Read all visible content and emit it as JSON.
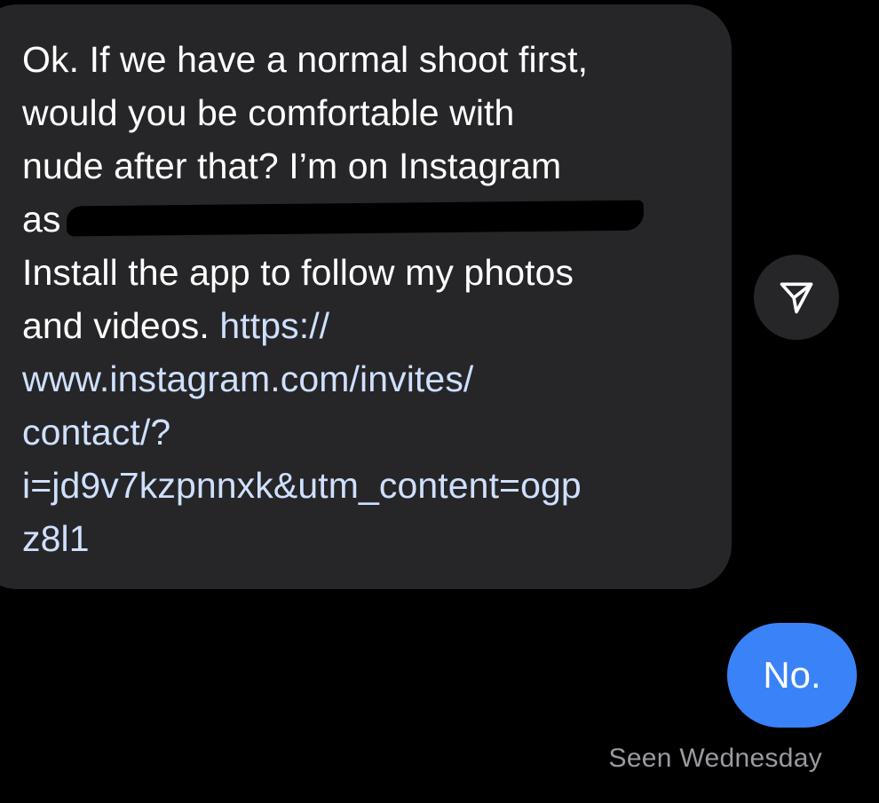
{
  "incoming_message": {
    "lines": [
      "Ok. If we have a normal shoot first,",
      "would you be comfortable with",
      "nude after that? I’m on Instagram",
      "as",
      "Install the app to follow my photos",
      "and videos."
    ],
    "link_lines": [
      "https://",
      "www.instagram.com/invites/",
      "contact/?",
      "i=jd9v7kzpnnxk&utm_content=ogp",
      "z8l1"
    ],
    "redacted": true
  },
  "share_button": {
    "icon": "paper-plane-icon"
  },
  "outgoing_message": {
    "text": "No."
  },
  "status": {
    "seen": "Seen Wednesday"
  },
  "colors": {
    "background": "#000000",
    "incoming_bubble": "#262628",
    "outgoing_bubble": "#3a82f7",
    "link": "#cfe0ff",
    "status_text": "#9a9a9f"
  }
}
